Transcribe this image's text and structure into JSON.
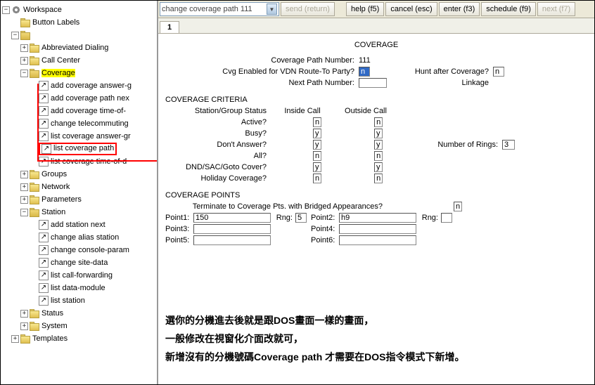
{
  "sidebar": {
    "workspace": "Workspace",
    "button_labels": "Button Labels",
    "abbrev": "Abbreviated Dialing",
    "call_center": "Call Center",
    "coverage": "Coverage",
    "coverage_items": [
      "add coverage answer-g",
      "add coverage path nex",
      "add coverage time-of-",
      "change telecommuting",
      "list coverage answer-gr",
      "list coverage path",
      "list coverage time-of-d"
    ],
    "groups": "Groups",
    "network": "Network",
    "parameters": "Parameters",
    "station": "Station",
    "station_items": [
      "add station next",
      "change alias station",
      "change console-param",
      "change site-data",
      "list call-forwarding",
      "list data-module",
      "list station"
    ],
    "status": "Status",
    "system": "System",
    "templates": "Templates"
  },
  "toolbar": {
    "combo": "change coverage path 111",
    "send": "send (return)",
    "help": "help (f5)",
    "cancel": "cancel (esc)",
    "enter": "enter (f3)",
    "schedule": "schedule (f9)",
    "next": "next (f7)"
  },
  "tab": "1",
  "page": {
    "title": "COVERAGE",
    "cpn_label": "Coverage Path Number:",
    "cpn_value": "111",
    "cvg_label": "Cvg Enabled for VDN Route-To Party?",
    "cvg_value": "n",
    "hunt_label": "Hunt after Coverage?",
    "hunt_value": "n",
    "next_label": "Next Path Number:",
    "next_value": "",
    "linkage_label": "Linkage",
    "criteria_hdr": "COVERAGE CRITERIA",
    "sg_label": "Station/Group Status",
    "inside_label": "Inside Call",
    "outside_label": "Outside Call",
    "active_label": "Active?",
    "busy_label": "Busy?",
    "dont_label": "Don't Answer?",
    "all_label": "All?",
    "dnd_label": "DND/SAC/Goto Cover?",
    "holiday_label": "Holiday Coverage?",
    "rings_label": "Number of Rings:",
    "rings_value": "3",
    "active_in": "n",
    "active_out": "n",
    "busy_in": "y",
    "busy_out": "y",
    "dont_in": "y",
    "dont_out": "y",
    "all_in": "n",
    "all_out": "n",
    "dnd_in": "y",
    "dnd_out": "y",
    "holiday_in": "n",
    "holiday_out": "n",
    "points_hdr": "COVERAGE POINTS",
    "terminate_label": "Terminate to Coverage Pts. with Bridged Appearances?",
    "terminate_value": "n",
    "p1_label": "Point1:",
    "p1_value": "150",
    "p2_label": "Point2:",
    "p2_value": "h9",
    "p3_label": "Point3:",
    "p3_value": "",
    "p4_label": "Point4:",
    "p4_value": "",
    "p5_label": "Point5:",
    "p5_value": "",
    "p6_label": "Point6:",
    "p6_value": "",
    "rng_label": "Rng:",
    "rng1_value": "5",
    "rng2_value": ""
  },
  "annotation": {
    "line1": "選你的分機進去後就是跟DOS畫面一樣的畫面，",
    "line2": "一般修改在視窗化介面改就可，",
    "line3": "新增沒有的分機號碼Coverage path 才需要在DOS指令模式下新增。"
  }
}
